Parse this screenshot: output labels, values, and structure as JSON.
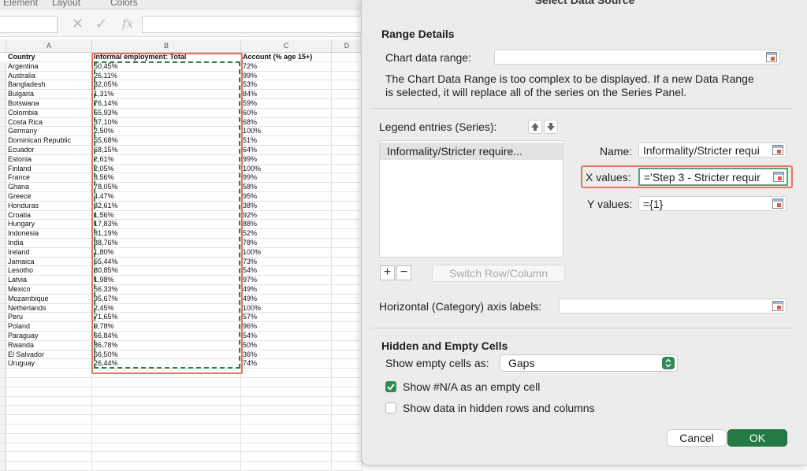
{
  "ribbon": {
    "tabs": [
      "Element",
      "Layout",
      "Colors"
    ]
  },
  "sheet": {
    "columns": [
      "A",
      "B",
      "C",
      "D"
    ],
    "header": [
      "Country",
      "Informal employment: Total",
      "Account (% age 15+)"
    ],
    "rows": [
      [
        "Argentina",
        "50,45%",
        "72%"
      ],
      [
        "Australia",
        "26,11%",
        "99%"
      ],
      [
        "Bangladesh",
        "82,05%",
        "53%"
      ],
      [
        "Bulgaria",
        "1,31%",
        "84%"
      ],
      [
        "Botswana",
        "76,14%",
        "59%"
      ],
      [
        "Colombia",
        "55,93%",
        "60%"
      ],
      [
        "Costa Rica",
        "37,10%",
        "68%"
      ],
      [
        "Germany",
        "2,50%",
        "100%"
      ],
      [
        "Dominican Republic",
        "55,68%",
        "51%"
      ],
      [
        "Ecuador",
        "68,15%",
        "64%"
      ],
      [
        "Estonia",
        "2,61%",
        "99%"
      ],
      [
        "Finland",
        "2,05%",
        "100%"
      ],
      [
        "France",
        "3,56%",
        "99%"
      ],
      [
        "Ghana",
        "78,05%",
        "58%"
      ],
      [
        "Greece",
        "4,47%",
        "95%"
      ],
      [
        "Honduras",
        "82,61%",
        "38%"
      ],
      [
        "Croatia",
        "1,56%",
        "92%"
      ],
      [
        "Hungary",
        "17,83%",
        "88%"
      ],
      [
        "Indonesia",
        "81,19%",
        "52%"
      ],
      [
        "India",
        "88,76%",
        "78%"
      ],
      [
        "Ireland",
        "1,80%",
        "100%"
      ],
      [
        "Jamaica",
        "55,44%",
        "73%"
      ],
      [
        "Lesotho",
        "80,85%",
        "54%"
      ],
      [
        "Latvia",
        "1,98%",
        "97%"
      ],
      [
        "Mexico",
        "56,33%",
        "49%"
      ],
      [
        "Mozambique",
        "95,67%",
        "49%"
      ],
      [
        "Netherlands",
        "2,45%",
        "100%"
      ],
      [
        "Peru",
        "71,65%",
        "57%"
      ],
      [
        "Poland",
        "9,78%",
        "96%"
      ],
      [
        "Paraguay",
        "66,84%",
        "54%"
      ],
      [
        "Rwanda",
        "86,78%",
        "50%"
      ],
      [
        "El Salvador",
        "66,50%",
        "36%"
      ],
      [
        "Uruguay",
        "26,44%",
        "74%"
      ]
    ]
  },
  "dialog": {
    "title": "Select Data Source",
    "range_details": {
      "heading": "Range Details",
      "chart_range_label": "Chart data range:",
      "chart_range_value": "",
      "message": "The Chart Data Range is too complex to be displayed. If a new Data Range is selected, it will replace all of the series on the Series Panel."
    },
    "series": {
      "legend_label": "Legend entries (Series):",
      "items": [
        "Informality/Stricter require..."
      ],
      "name_label": "Name:",
      "name_value": "Informality/Stricter requi",
      "x_label": "X values:",
      "x_value": "='Step 3 - Stricter requir",
      "y_label": "Y values:",
      "y_value": "={1}",
      "add_label": "+",
      "remove_label": "−",
      "switch_label": "Switch Row/Column"
    },
    "axis_label": "Horizontal (Category) axis labels:",
    "hidden": {
      "heading": "Hidden and Empty Cells",
      "show_empty_label": "Show empty cells as:",
      "show_empty_value": "Gaps",
      "na_label": "Show #N/A as an empty cell",
      "na_checked": true,
      "hidden_label": "Show data in hidden rows and columns",
      "hidden_checked": false
    },
    "cancel_label": "Cancel",
    "ok_label": "OK"
  },
  "colors": {
    "accent": "#2f8a55",
    "highlight": "#e8735f"
  }
}
